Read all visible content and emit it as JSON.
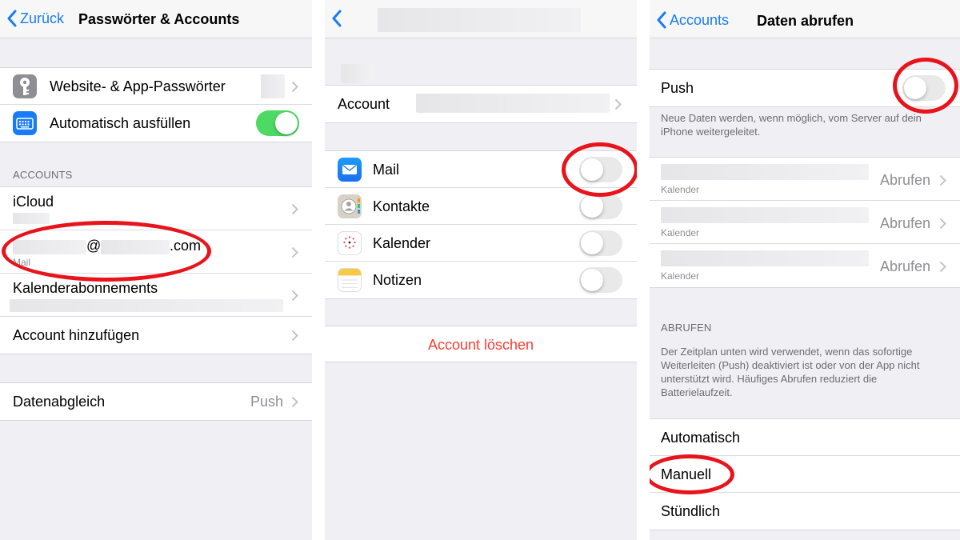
{
  "panel1": {
    "back_label": "Zurück",
    "title": "Passwörter & Accounts",
    "passwords_label": "Website- & App-Passwörter",
    "autofill_label": "Automatisch ausfüllen",
    "autofill_on": true,
    "accounts_header": "ACCOUNTS",
    "icloud_label": "iCloud",
    "email_at": "@",
    "email_domain": ".com",
    "email_sub": "Mail",
    "calendars_label": "Kalenderabonnements",
    "add_account_label": "Account hinzufügen",
    "sync_label": "Datenabgleich",
    "sync_value": "Push"
  },
  "panel2": {
    "account_label": "Account",
    "mail_label": "Mail",
    "contacts_label": "Kontakte",
    "calendar_label": "Kalender",
    "notes_label": "Notizen",
    "delete_label": "Account löschen"
  },
  "panel3": {
    "back_label": "Accounts",
    "title": "Daten abrufen",
    "push_label": "Push",
    "push_on": false,
    "push_note": "Neue Daten werden, wenn möglich, vom Server auf dein iPhone weitergeleitet.",
    "fetch_rows": [
      {
        "sub": "Kalender",
        "value": "Abrufen"
      },
      {
        "sub": "Kalender",
        "value": "Abrufen"
      },
      {
        "sub": "Kalender",
        "value": "Abrufen"
      }
    ],
    "fetch_header": "ABRUFEN",
    "fetch_note": "Der Zeitplan unten wird verwendet, wenn das sofortige Weiterleiten (Push) deaktiviert ist oder von der App nicht unterstützt wird. Häufiges Abrufen reduziert die Batterielaufzeit.",
    "options": [
      "Automatisch",
      "Manuell",
      "Stündlich"
    ]
  },
  "colors": {
    "accent": "#1a7cf5",
    "toggle_on": "#4cd964",
    "destructive": "#ff3b30",
    "annotation": "#e8141c"
  }
}
